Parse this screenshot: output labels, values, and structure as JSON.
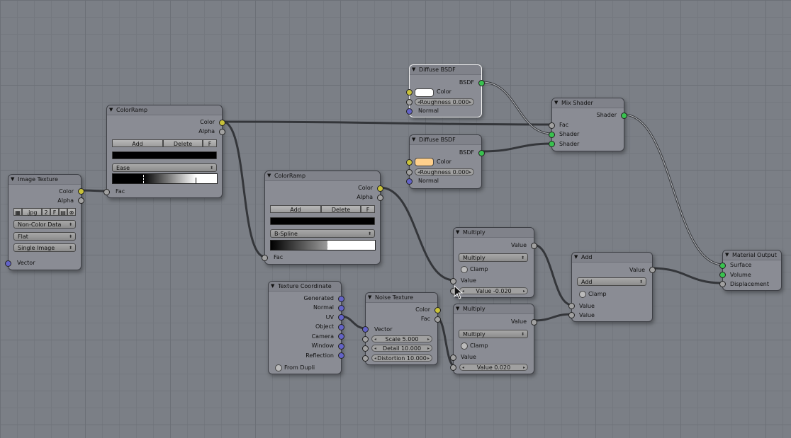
{
  "nodes": {
    "image_texture": {
      "title": "Image Texture",
      "outputs": [
        "Color",
        "Alpha"
      ],
      "image_ext": ".jpg",
      "users": "2",
      "fake_user": "F",
      "color_space": "Non-Color Data",
      "projection": "Flat",
      "source": "Single Image",
      "input": "Vector"
    },
    "colorramp_1": {
      "title": "ColorRamp",
      "outputs": [
        "Color",
        "Alpha"
      ],
      "add_label": "Add",
      "delete_label": "Delete",
      "flip_label": "F",
      "interpolation": "Ease",
      "input": "Fac"
    },
    "colorramp_2": {
      "title": "ColorRamp",
      "outputs": [
        "Color",
        "Alpha"
      ],
      "add_label": "Add",
      "delete_label": "Delete",
      "flip_label": "F",
      "interpolation": "B-Spline",
      "input": "Fac"
    },
    "diffuse_1": {
      "title": "Diffuse BSDF",
      "output": "BSDF",
      "color_label": "Color",
      "color": "#ffffff",
      "roughness": "Roughness 0.000",
      "normal": "Normal"
    },
    "diffuse_2": {
      "title": "Diffuse BSDF",
      "output": "BSDF",
      "color_label": "Color",
      "color": "#ffd08c",
      "roughness": "Roughness 0.000",
      "normal": "Normal"
    },
    "mix_shader": {
      "title": "Mix Shader",
      "output": "Shader",
      "inputs": [
        "Fac",
        "Shader",
        "Shader"
      ]
    },
    "multiply_1": {
      "title": "Multiply",
      "output": "Value",
      "operation": "Multiply",
      "clamp": "Clamp",
      "input_label": "Value",
      "value": "Value -0.020"
    },
    "multiply_2": {
      "title": "Multiply",
      "output": "Value",
      "operation": "Multiply",
      "clamp": "Clamp",
      "input_label": "Value",
      "value": "Value 0.020"
    },
    "add": {
      "title": "Add",
      "output": "Value",
      "operation": "Add",
      "clamp": "Clamp",
      "inputs": [
        "Value",
        "Value"
      ]
    },
    "material_output": {
      "title": "Material Output",
      "inputs": [
        "Surface",
        "Volume",
        "Displacement"
      ]
    },
    "texture_coordinate": {
      "title": "Texture Coordinate",
      "outputs": [
        "Generated",
        "Normal",
        "UV",
        "Object",
        "Camera",
        "Window",
        "Reflection"
      ],
      "from_dupli": "From Dupli"
    },
    "noise_texture": {
      "title": "Noise Texture",
      "outputs": [
        "Color",
        "Fac"
      ],
      "input": "Vector",
      "scale": "Scale 5.000",
      "detail": "Detail 10.000",
      "distortion": "Distortion 10.000"
    }
  },
  "colors": {
    "background": "#7b7f86",
    "node_body": "#8a8c94",
    "wire": "#34363a",
    "socket_color": "#c9c23a",
    "socket_value": "#a1a1a1",
    "socket_shader": "#39c24f",
    "socket_vector": "#6363c7"
  }
}
